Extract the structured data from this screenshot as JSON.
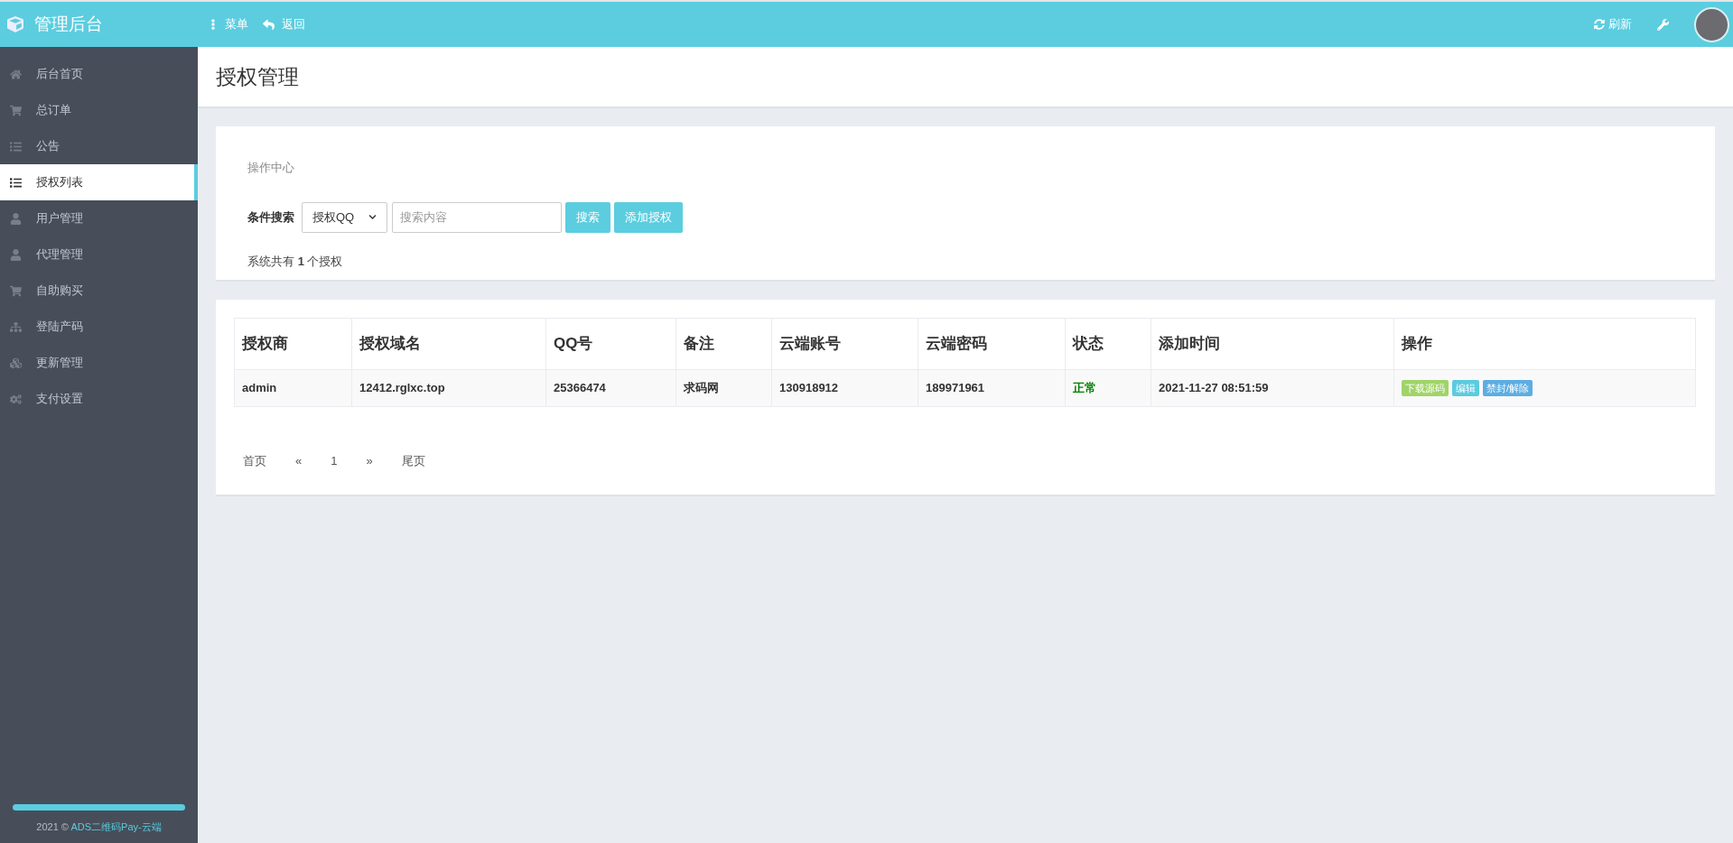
{
  "header": {
    "title": "管理后台",
    "menu": "菜单",
    "back": "返回",
    "refresh": "刷新"
  },
  "sidebar": {
    "items": [
      {
        "label": "后台首页",
        "kind": "home",
        "selected": false
      },
      {
        "label": "总订单",
        "kind": "cart",
        "selected": false
      },
      {
        "label": "公告",
        "kind": "list",
        "selected": false
      },
      {
        "label": "授权列表",
        "kind": "list",
        "selected": true
      },
      {
        "label": "用户管理",
        "kind": "user",
        "selected": false
      },
      {
        "label": "代理管理",
        "kind": "user",
        "selected": false
      },
      {
        "label": "自助购买",
        "kind": "cart",
        "selected": false
      },
      {
        "label": "登陆产码",
        "kind": "sitemap",
        "selected": false
      },
      {
        "label": "更新管理",
        "kind": "cubes",
        "selected": false
      },
      {
        "label": "支付设置",
        "kind": "gears",
        "selected": false
      }
    ],
    "footer": {
      "prefix": "2021 ©",
      "link": "ADS二维码Pay-云端"
    }
  },
  "page_title": "授权管理",
  "operation": {
    "heading": "操作中心",
    "search_label": "条件搜索",
    "select_value": "授权QQ",
    "placeholder": "搜索内容",
    "search_button": "搜索",
    "add_button": "添加授权",
    "summary": "系统共有 **1** 个授权"
  },
  "table": {
    "columns": [
      "授权商",
      "授权域名",
      "QQ号",
      "备注",
      "云端账号",
      "云端密码",
      "状态",
      "添加时间",
      "操作"
    ],
    "rows": [
      {
        "cells": [
          "admin",
          "12412.rglxc.top",
          "25366474",
          "求码网",
          "130918912",
          "189971961"
        ],
        "status": {
          "label": "正常",
          "color": "#008000"
        },
        "time": "2021-11-27 08:51:59",
        "actions": [
          {
            "label": "下载源码",
            "color": "#a0d468"
          },
          {
            "label": "编辑",
            "color": "#5bcbdf"
          },
          {
            "label": "禁封/解除",
            "color": "#5dade2"
          }
        ]
      }
    ]
  },
  "pagination": [
    "首页",
    "«",
    "1",
    "»",
    "尾页"
  ]
}
